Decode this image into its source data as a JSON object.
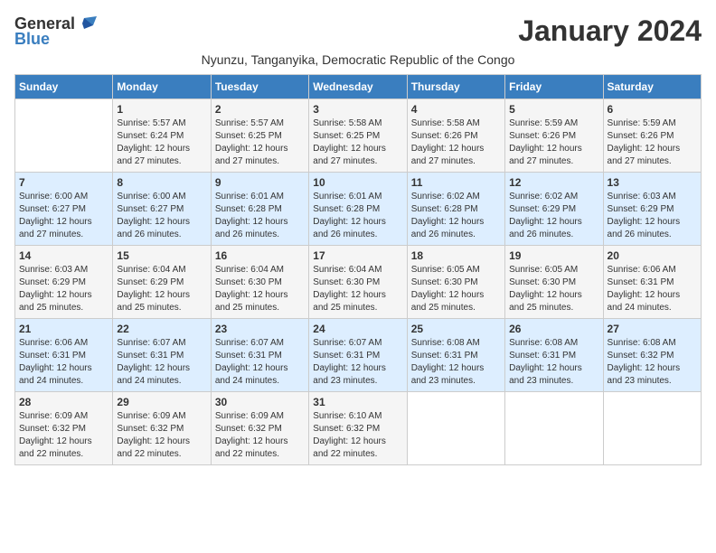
{
  "header": {
    "logo_general": "General",
    "logo_blue": "Blue",
    "month_title": "January 2024",
    "subtitle": "Nyunzu, Tanganyika, Democratic Republic of the Congo"
  },
  "weekdays": [
    "Sunday",
    "Monday",
    "Tuesday",
    "Wednesday",
    "Thursday",
    "Friday",
    "Saturday"
  ],
  "weeks": [
    [
      {
        "day": "",
        "sunrise": "",
        "sunset": "",
        "daylight": ""
      },
      {
        "day": "1",
        "sunrise": "Sunrise: 5:57 AM",
        "sunset": "Sunset: 6:24 PM",
        "daylight": "Daylight: 12 hours and 27 minutes."
      },
      {
        "day": "2",
        "sunrise": "Sunrise: 5:57 AM",
        "sunset": "Sunset: 6:25 PM",
        "daylight": "Daylight: 12 hours and 27 minutes."
      },
      {
        "day": "3",
        "sunrise": "Sunrise: 5:58 AM",
        "sunset": "Sunset: 6:25 PM",
        "daylight": "Daylight: 12 hours and 27 minutes."
      },
      {
        "day": "4",
        "sunrise": "Sunrise: 5:58 AM",
        "sunset": "Sunset: 6:26 PM",
        "daylight": "Daylight: 12 hours and 27 minutes."
      },
      {
        "day": "5",
        "sunrise": "Sunrise: 5:59 AM",
        "sunset": "Sunset: 6:26 PM",
        "daylight": "Daylight: 12 hours and 27 minutes."
      },
      {
        "day": "6",
        "sunrise": "Sunrise: 5:59 AM",
        "sunset": "Sunset: 6:26 PM",
        "daylight": "Daylight: 12 hours and 27 minutes."
      }
    ],
    [
      {
        "day": "7",
        "sunrise": "Sunrise: 6:00 AM",
        "sunset": "Sunset: 6:27 PM",
        "daylight": "Daylight: 12 hours and 27 minutes."
      },
      {
        "day": "8",
        "sunrise": "Sunrise: 6:00 AM",
        "sunset": "Sunset: 6:27 PM",
        "daylight": "Daylight: 12 hours and 26 minutes."
      },
      {
        "day": "9",
        "sunrise": "Sunrise: 6:01 AM",
        "sunset": "Sunset: 6:28 PM",
        "daylight": "Daylight: 12 hours and 26 minutes."
      },
      {
        "day": "10",
        "sunrise": "Sunrise: 6:01 AM",
        "sunset": "Sunset: 6:28 PM",
        "daylight": "Daylight: 12 hours and 26 minutes."
      },
      {
        "day": "11",
        "sunrise": "Sunrise: 6:02 AM",
        "sunset": "Sunset: 6:28 PM",
        "daylight": "Daylight: 12 hours and 26 minutes."
      },
      {
        "day": "12",
        "sunrise": "Sunrise: 6:02 AM",
        "sunset": "Sunset: 6:29 PM",
        "daylight": "Daylight: 12 hours and 26 minutes."
      },
      {
        "day": "13",
        "sunrise": "Sunrise: 6:03 AM",
        "sunset": "Sunset: 6:29 PM",
        "daylight": "Daylight: 12 hours and 26 minutes."
      }
    ],
    [
      {
        "day": "14",
        "sunrise": "Sunrise: 6:03 AM",
        "sunset": "Sunset: 6:29 PM",
        "daylight": "Daylight: 12 hours and 25 minutes."
      },
      {
        "day": "15",
        "sunrise": "Sunrise: 6:04 AM",
        "sunset": "Sunset: 6:29 PM",
        "daylight": "Daylight: 12 hours and 25 minutes."
      },
      {
        "day": "16",
        "sunrise": "Sunrise: 6:04 AM",
        "sunset": "Sunset: 6:30 PM",
        "daylight": "Daylight: 12 hours and 25 minutes."
      },
      {
        "day": "17",
        "sunrise": "Sunrise: 6:04 AM",
        "sunset": "Sunset: 6:30 PM",
        "daylight": "Daylight: 12 hours and 25 minutes."
      },
      {
        "day": "18",
        "sunrise": "Sunrise: 6:05 AM",
        "sunset": "Sunset: 6:30 PM",
        "daylight": "Daylight: 12 hours and 25 minutes."
      },
      {
        "day": "19",
        "sunrise": "Sunrise: 6:05 AM",
        "sunset": "Sunset: 6:30 PM",
        "daylight": "Daylight: 12 hours and 25 minutes."
      },
      {
        "day": "20",
        "sunrise": "Sunrise: 6:06 AM",
        "sunset": "Sunset: 6:31 PM",
        "daylight": "Daylight: 12 hours and 24 minutes."
      }
    ],
    [
      {
        "day": "21",
        "sunrise": "Sunrise: 6:06 AM",
        "sunset": "Sunset: 6:31 PM",
        "daylight": "Daylight: 12 hours and 24 minutes."
      },
      {
        "day": "22",
        "sunrise": "Sunrise: 6:07 AM",
        "sunset": "Sunset: 6:31 PM",
        "daylight": "Daylight: 12 hours and 24 minutes."
      },
      {
        "day": "23",
        "sunrise": "Sunrise: 6:07 AM",
        "sunset": "Sunset: 6:31 PM",
        "daylight": "Daylight: 12 hours and 24 minutes."
      },
      {
        "day": "24",
        "sunrise": "Sunrise: 6:07 AM",
        "sunset": "Sunset: 6:31 PM",
        "daylight": "Daylight: 12 hours and 23 minutes."
      },
      {
        "day": "25",
        "sunrise": "Sunrise: 6:08 AM",
        "sunset": "Sunset: 6:31 PM",
        "daylight": "Daylight: 12 hours and 23 minutes."
      },
      {
        "day": "26",
        "sunrise": "Sunrise: 6:08 AM",
        "sunset": "Sunset: 6:31 PM",
        "daylight": "Daylight: 12 hours and 23 minutes."
      },
      {
        "day": "27",
        "sunrise": "Sunrise: 6:08 AM",
        "sunset": "Sunset: 6:32 PM",
        "daylight": "Daylight: 12 hours and 23 minutes."
      }
    ],
    [
      {
        "day": "28",
        "sunrise": "Sunrise: 6:09 AM",
        "sunset": "Sunset: 6:32 PM",
        "daylight": "Daylight: 12 hours and 22 minutes."
      },
      {
        "day": "29",
        "sunrise": "Sunrise: 6:09 AM",
        "sunset": "Sunset: 6:32 PM",
        "daylight": "Daylight: 12 hours and 22 minutes."
      },
      {
        "day": "30",
        "sunrise": "Sunrise: 6:09 AM",
        "sunset": "Sunset: 6:32 PM",
        "daylight": "Daylight: 12 hours and 22 minutes."
      },
      {
        "day": "31",
        "sunrise": "Sunrise: 6:10 AM",
        "sunset": "Sunset: 6:32 PM",
        "daylight": "Daylight: 12 hours and 22 minutes."
      },
      {
        "day": "",
        "sunrise": "",
        "sunset": "",
        "daylight": ""
      },
      {
        "day": "",
        "sunrise": "",
        "sunset": "",
        "daylight": ""
      },
      {
        "day": "",
        "sunrise": "",
        "sunset": "",
        "daylight": ""
      }
    ]
  ]
}
